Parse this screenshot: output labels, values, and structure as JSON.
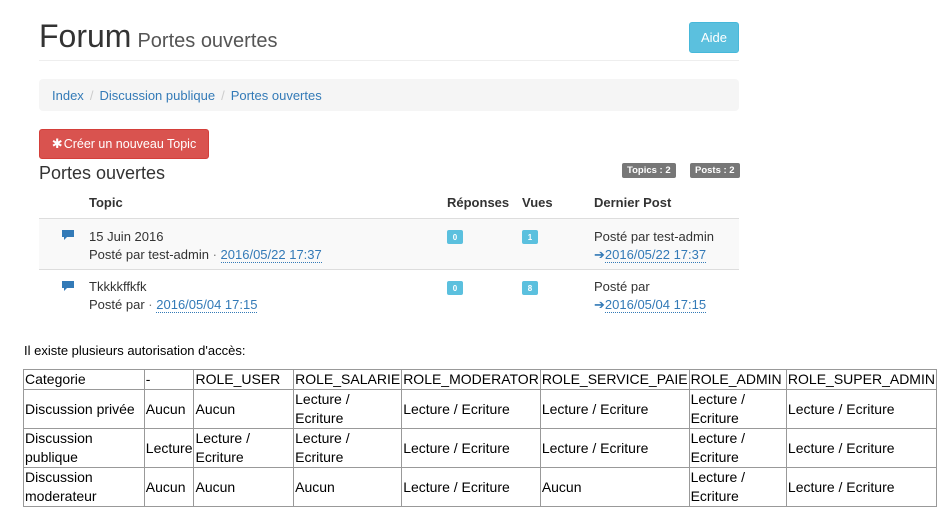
{
  "header": {
    "title": "Forum",
    "subtitle": "Portes ouvertes",
    "help_label": "Aide"
  },
  "breadcrumb": [
    "Index",
    "Discussion publique",
    "Portes ouvertes"
  ],
  "new_topic_label": "Créer un nouveau Topic",
  "section_title": "Portes ouvertes",
  "badges": {
    "topics": "Topics : 2",
    "posts": "Posts : 2"
  },
  "table": {
    "headers": {
      "topic": "Topic",
      "responses": "Réponses",
      "views": "Vues",
      "last_post": "Dernier Post"
    },
    "rows": [
      {
        "title": "15 Juin 2016",
        "posted_by": "Posté par test-admin",
        "sep": "·",
        "date": "2016/05/22 17:37",
        "responses": "0",
        "views": "1",
        "last_by": "Posté par test-admin",
        "last_date": "2016/05/22 17:37"
      },
      {
        "title": "Tkkkkffkfk",
        "posted_by": "Posté par",
        "sep": "·",
        "date": "2016/05/04 17:15",
        "responses": "0",
        "views": "8",
        "last_by": "Posté par",
        "last_date": "2016/05/04 17:15"
      }
    ]
  },
  "intro": "Il existe plusieurs autorisation d'accès:",
  "permissions": {
    "headers": [
      "Categorie",
      "-",
      "ROLE_USER",
      "ROLE_SALARIE",
      "ROLE_MODERATOR",
      "ROLE_SERVICE_PAIE",
      "ROLE_ADMIN",
      "ROLE_SUPER_ADMIN"
    ],
    "rows": [
      [
        "Discussion privée",
        "Aucun",
        "Aucun",
        "Lecture / Ecriture",
        "Lecture / Ecriture",
        "Lecture / Ecriture",
        "Lecture / Ecriture",
        "Lecture / Ecriture"
      ],
      [
        "Discussion publique",
        "Lecture",
        "Lecture / Ecriture",
        "Lecture / Ecriture",
        "Lecture / Ecriture",
        "Lecture / Ecriture",
        "Lecture / Ecriture",
        "Lecture / Ecriture"
      ],
      [
        "Discussion moderateur",
        "Aucun",
        "Aucun",
        "Aucun",
        "Lecture / Ecriture",
        "Aucun",
        "Lecture / Ecriture",
        "Lecture / Ecriture"
      ]
    ]
  },
  "colors": {
    "primary": "#337ab7",
    "info": "#5bc0de",
    "danger": "#d9534f",
    "muted_badge": "#777777"
  },
  "icons": {
    "topic": "comment-icon",
    "new_topic": "asterisk-icon",
    "last_post": "arrow-right-icon"
  }
}
